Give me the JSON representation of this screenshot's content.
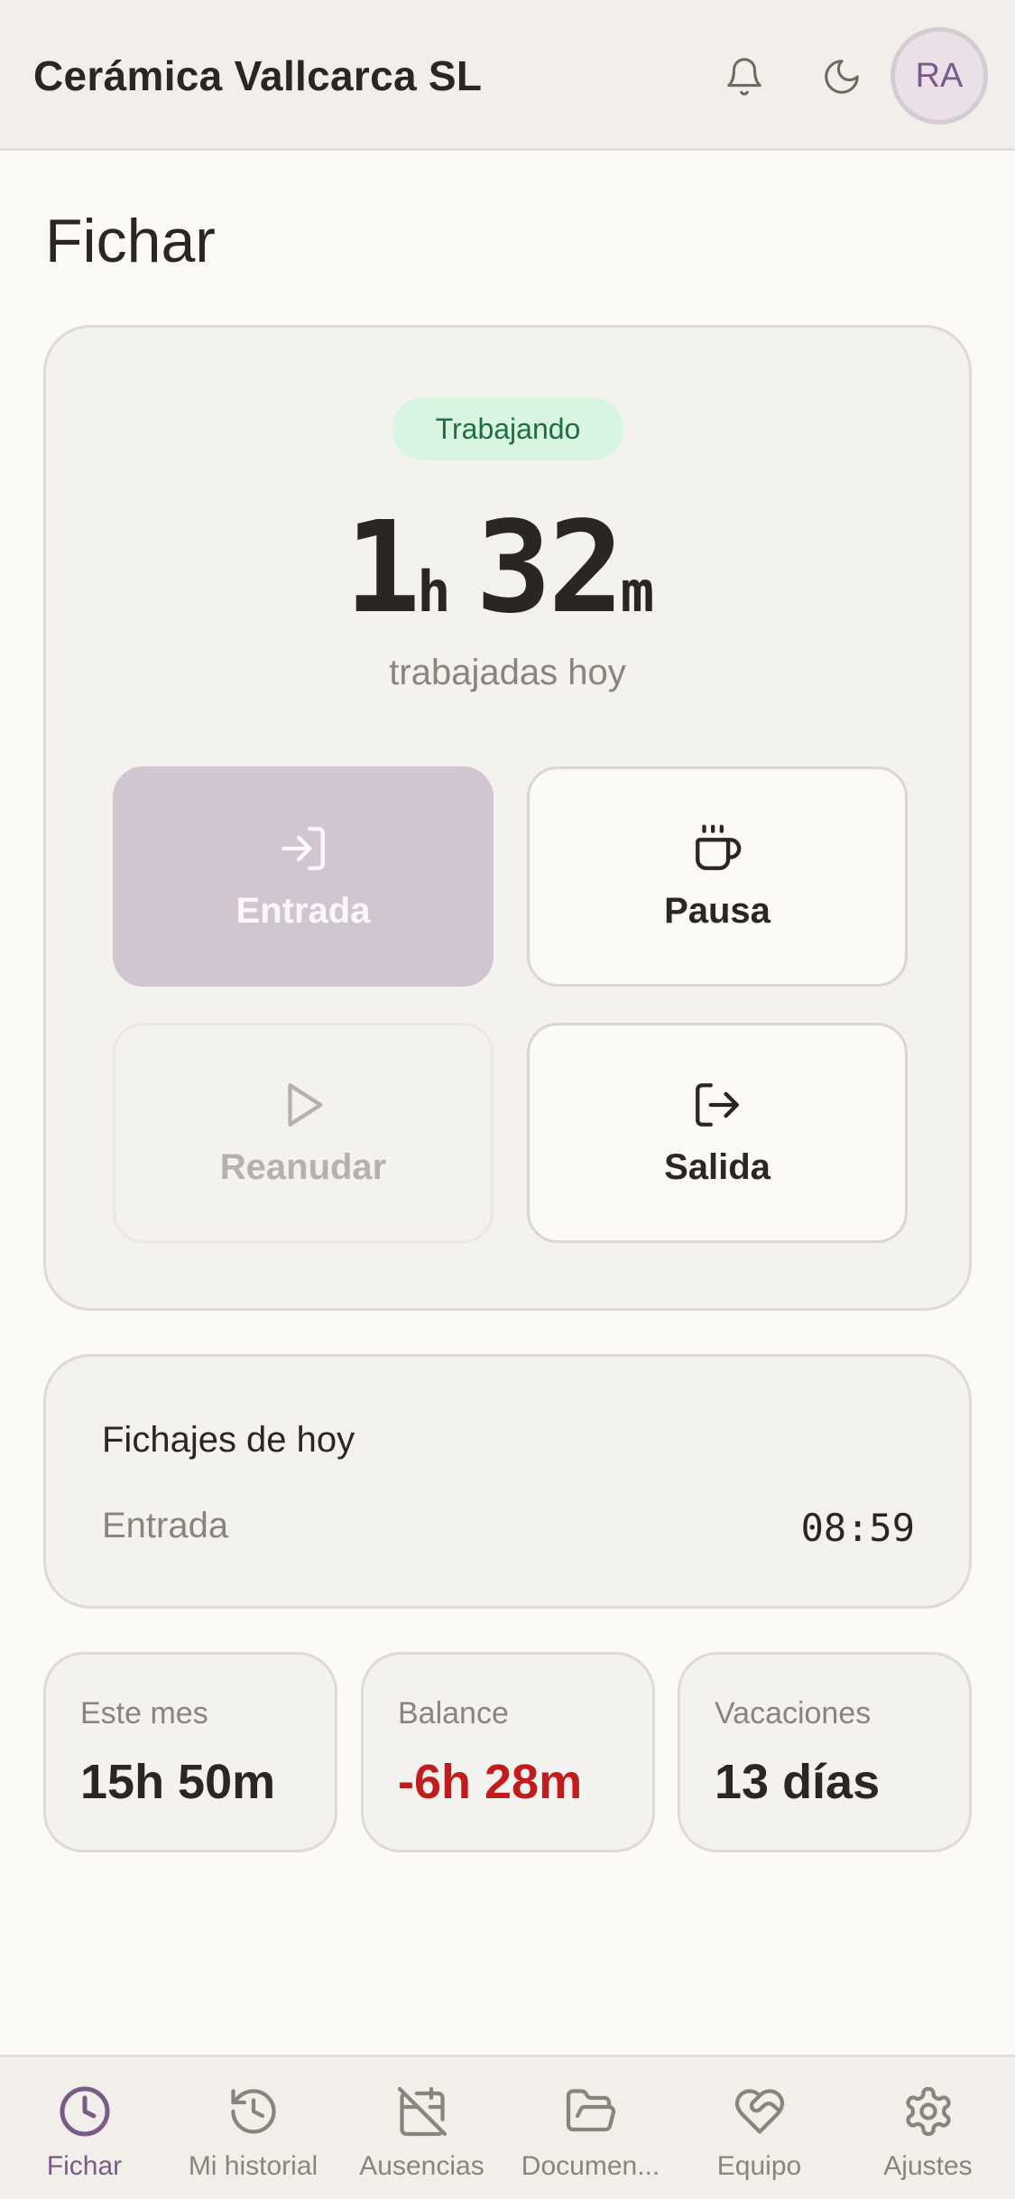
{
  "header": {
    "company": "Cerámica Vallcarca SL",
    "icons": [
      "bell-icon",
      "moon-icon"
    ],
    "avatar_initials": "RA"
  },
  "main": {
    "title": "Fichar",
    "status": "Trabajando",
    "timer": {
      "hours": "1",
      "hours_unit": "h",
      "minutes": "32",
      "minutes_unit": "m"
    },
    "timer_label": "trabajadas hoy",
    "actions": {
      "entrada": {
        "label": "Entrada",
        "icon": "log-in-icon",
        "state": "disabled-active"
      },
      "pausa": {
        "label": "Pausa",
        "icon": "coffee-icon"
      },
      "reanudar": {
        "label": "Reanudar",
        "icon": "play-icon",
        "state": "disabled"
      },
      "salida": {
        "label": "Salida",
        "icon": "log-out-icon"
      }
    }
  },
  "today": {
    "title": "Fichajes de hoy",
    "entries": [
      {
        "label": "Entrada",
        "time": "08:59"
      }
    ]
  },
  "stats": [
    {
      "label": "Este mes",
      "value": "15h 50m"
    },
    {
      "label": "Balance",
      "value": "-6h 28m",
      "color": "#c21b1b"
    },
    {
      "label": "Vacaciones",
      "value": "13 días"
    }
  ],
  "nav": [
    {
      "label": "Fichar",
      "icon": "clock-icon",
      "active": true
    },
    {
      "label": "Mi historial",
      "icon": "history-icon",
      "active": false
    },
    {
      "label": "Ausencias",
      "icon": "calendar-off-icon",
      "active": false
    },
    {
      "label": "Documen...",
      "icon": "folder-icon",
      "active": false
    },
    {
      "label": "Equipo",
      "icon": "heart-handshake-icon",
      "active": false
    },
    {
      "label": "Ajustes",
      "icon": "gear-icon",
      "active": false
    }
  ],
  "colors": {
    "accent": "#7a5a86",
    "status_bg": "#d8f5e2",
    "status_text": "#1e6e41",
    "negative": "#c21b1b"
  }
}
